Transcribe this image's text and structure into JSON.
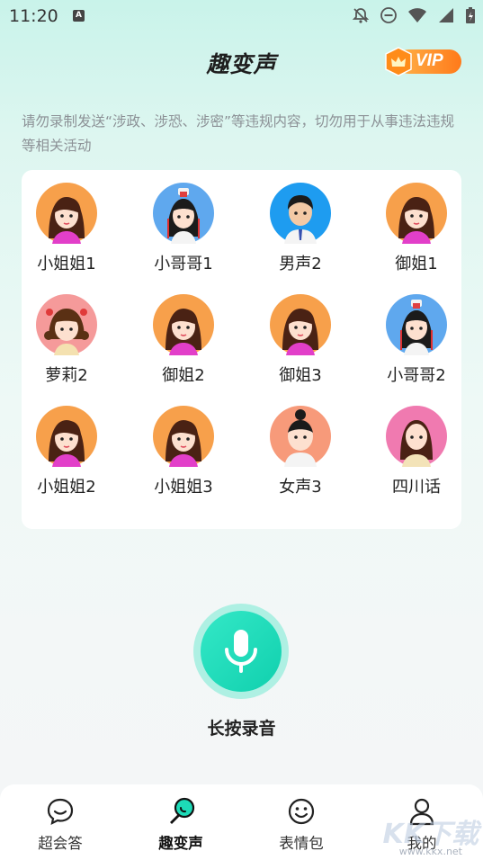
{
  "status_bar": {
    "time": "11:20",
    "notification_glyph": "A"
  },
  "header": {
    "title": "趣变声",
    "vip_label": "VIP"
  },
  "notice": "请勿录制发送“涉政、涉恐、涉密”等违规内容，切勿用于从事违法违规等相关活动",
  "voices": [
    {
      "label": "小姐姐1",
      "avatar": "girl-orange-icon"
    },
    {
      "label": "小哥哥1",
      "avatar": "ancient-boy-icon"
    },
    {
      "label": "男声2",
      "avatar": "man-suit-icon"
    },
    {
      "label": "御姐1",
      "avatar": "girl-orange-icon"
    },
    {
      "label": "萝莉2",
      "avatar": "little-girl-icon"
    },
    {
      "label": "御姐2",
      "avatar": "girl-orange-icon"
    },
    {
      "label": "御姐3",
      "avatar": "girl-orange-icon"
    },
    {
      "label": "小哥哥2",
      "avatar": "ancient-boy-icon"
    },
    {
      "label": "小姐姐2",
      "avatar": "girl-orange-icon"
    },
    {
      "label": "小姐姐3",
      "avatar": "girl-orange-icon"
    },
    {
      "label": "女声3",
      "avatar": "woman-bun-icon"
    },
    {
      "label": "四川话",
      "avatar": "woman-pink-icon"
    }
  ],
  "record": {
    "label": "长按录音",
    "icon": "microphone-icon"
  },
  "nav": [
    {
      "label": "超会答",
      "icon": "chat-bubble-icon",
      "active": false
    },
    {
      "label": "趣变声",
      "icon": "mic-voice-icon",
      "active": true
    },
    {
      "label": "表情包",
      "icon": "smiley-icon",
      "active": false
    },
    {
      "label": "我的",
      "icon": "person-icon",
      "active": false
    }
  ],
  "watermark": {
    "text": "KK下载",
    "url_text": "www.kkx.net"
  },
  "colors": {
    "accent": "#1ddbb8",
    "vip": "#f7941d",
    "notice": "#8c9196"
  }
}
